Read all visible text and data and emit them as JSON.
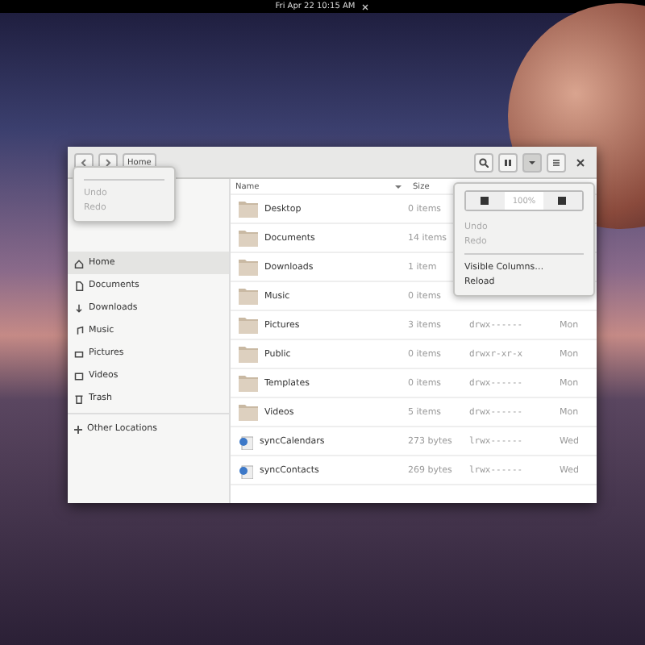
{
  "top_bar": {
    "clock": "Fri Apr 22  10:15 AM"
  },
  "header": {
    "path": "Home"
  },
  "undo_popover": {
    "items": [
      {
        "label": "Undo",
        "disabled": true
      },
      {
        "label": "Redo",
        "disabled": true
      }
    ]
  },
  "sidebar": {
    "items": [
      {
        "label": "Home",
        "selected": true
      },
      {
        "label": "Documents",
        "selected": false
      },
      {
        "label": "Downloads",
        "selected": false
      },
      {
        "label": "Music",
        "selected": false
      },
      {
        "label": "Pictures",
        "selected": false
      },
      {
        "label": "Videos",
        "selected": false
      },
      {
        "label": "Trash",
        "selected": false
      }
    ],
    "other": "Other Locations"
  },
  "table": {
    "columns": [
      "Name",
      "Size"
    ],
    "rows": [
      {
        "name": "Desktop",
        "kind": "folder",
        "size": "0 items"
      },
      {
        "name": "Documents",
        "kind": "folder",
        "size": "14 items"
      },
      {
        "name": "Downloads",
        "kind": "folder",
        "size": "1 item"
      },
      {
        "name": "Music",
        "kind": "folder",
        "size": "0 items"
      },
      {
        "name": "Pictures",
        "kind": "folder",
        "size": "3 items",
        "permissions": "drwx------",
        "modified": "Mon"
      },
      {
        "name": "Public",
        "kind": "folder",
        "size": "0 items",
        "permissions": "drwxr-xr-x",
        "modified": "Mon"
      },
      {
        "name": "Templates",
        "kind": "folder",
        "size": "0 items",
        "permissions": "drwx------",
        "modified": "Mon"
      },
      {
        "name": "Videos",
        "kind": "folder",
        "size": "5 items",
        "permissions": "drwx------",
        "modified": "Mon"
      },
      {
        "name": "syncCalendars",
        "kind": "link",
        "size": "273 bytes",
        "permissions": "lrwx------",
        "modified": "Wed"
      },
      {
        "name": "syncContacts",
        "kind": "link",
        "size": "269 bytes",
        "permissions": "lrwx------",
        "modified": "Wed"
      }
    ]
  },
  "menu_popover": {
    "zoom": "100%",
    "items": [
      {
        "label": "Undo",
        "disabled": true
      },
      {
        "label": "Redo",
        "disabled": true
      },
      {
        "label": "Visible Columns…",
        "disabled": false
      },
      {
        "label": "Reload",
        "disabled": false
      }
    ]
  }
}
